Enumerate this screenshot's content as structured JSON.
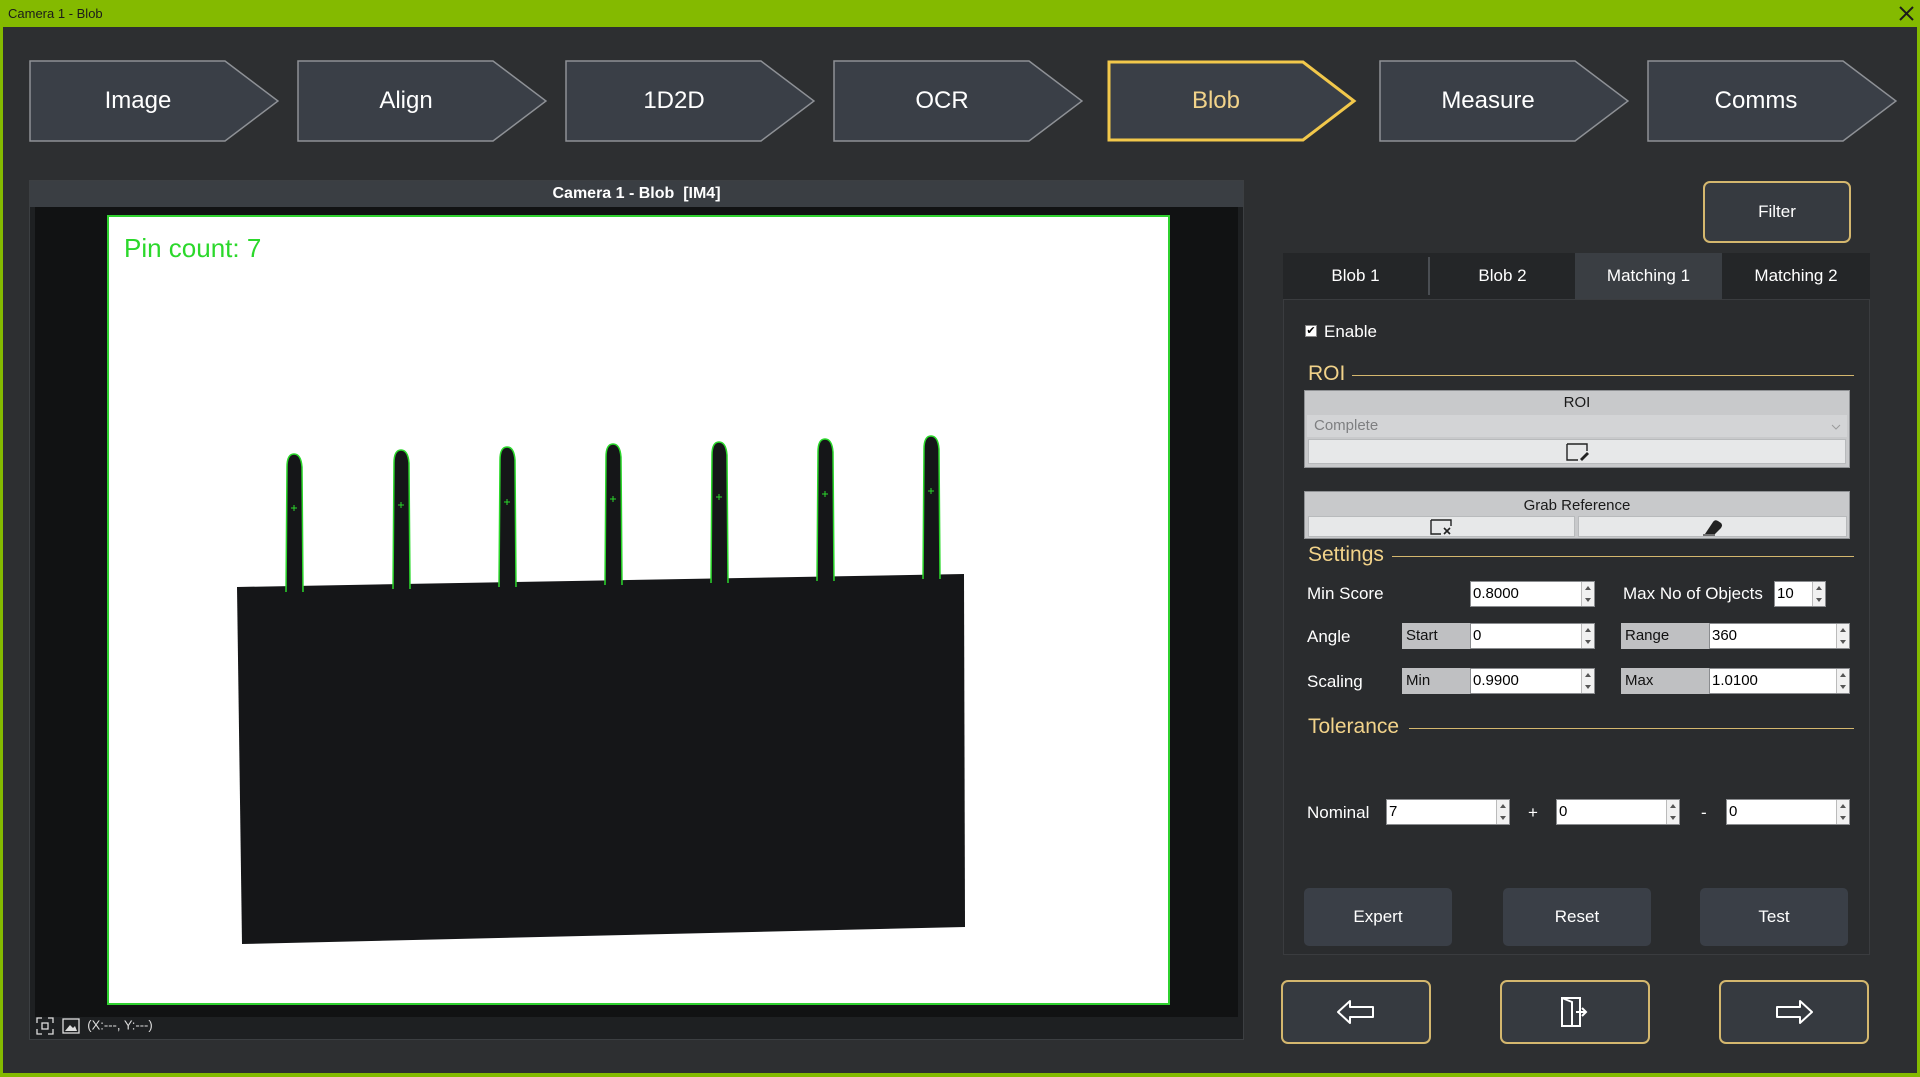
{
  "window": {
    "title": "Camera 1 - Blob"
  },
  "steps": [
    "Image",
    "Align",
    "1D2D",
    "OCR",
    "Blob",
    "Measure",
    "Comms"
  ],
  "active_step": "Blob",
  "viewer": {
    "header": "Camera 1 - Blob  [IM4]",
    "overlay_text": "Pin count: 7",
    "coords": "(X:---, Y:---)"
  },
  "filter_label": "Filter",
  "tabs": [
    "Blob 1",
    "Blob 2",
    "Matching 1",
    "Matching 2"
  ],
  "selected_tab": "Matching 1",
  "panel": {
    "enable_label": "Enable",
    "enable_checked": true,
    "roi_section": "ROI",
    "roi_box_title": "ROI",
    "roi_mode": "Complete",
    "grab_reference_label": "Grab Reference",
    "settings_section": "Settings",
    "min_score_label": "Min Score",
    "min_score": "0.8000",
    "max_objects_label": "Max No of Objects",
    "max_objects": "10",
    "angle_label": "Angle",
    "angle_start_tag": "Start",
    "angle_start": "0",
    "angle_range_tag": "Range",
    "angle_range": "360",
    "scaling_label": "Scaling",
    "scaling_min_tag": "Min",
    "scaling_min": "0.9900",
    "scaling_max_tag": "Max",
    "scaling_max": "1.0100",
    "tolerance_section": "Tolerance",
    "nominal_label": "Nominal",
    "nominal": "7",
    "plus_sign": "+",
    "plus_value": "0",
    "minus_sign": "-",
    "minus_value": "0",
    "expert_label": "Expert",
    "reset_label": "Reset",
    "test_label": "Test"
  },
  "colors": {
    "accent_green": "#84ba00",
    "gold": "#d4b76e",
    "active_text": "#f2d38a",
    "detection_green": "#2bd82b"
  }
}
